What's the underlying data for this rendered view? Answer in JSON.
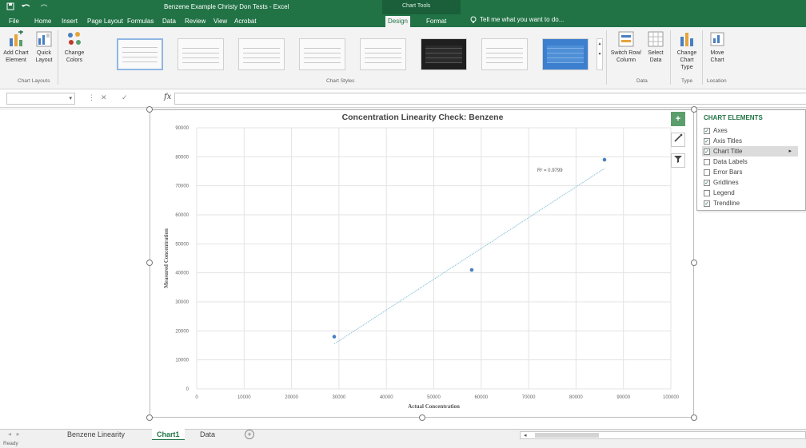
{
  "window": {
    "title": "Benzene Example Christy Don Tests - Excel",
    "context_tools_label": "Chart Tools"
  },
  "quick_access": {
    "save_icon": "save-icon",
    "undo_icon": "undo-icon",
    "redo_icon": "redo-icon"
  },
  "tabs": [
    "File",
    "Home",
    "Insert",
    "Page Layout",
    "Formulas",
    "Data",
    "Review",
    "View",
    "Acrobat",
    "Design",
    "Format"
  ],
  "active_tab": "Design",
  "tell_me": "Tell me what you want to do...",
  "ribbon": {
    "add_chart_element": "Add Chart Element",
    "quick_layout": "Quick Layout",
    "change_colors": "Change Colors",
    "chart_layouts_group": "Chart Layouts",
    "chart_styles_group": "Chart Styles",
    "switch_row_column": "Switch Row/ Column",
    "select_data": "Select Data",
    "data_group": "Data",
    "change_chart_type": "Change Chart Type",
    "type_group": "Type",
    "move_chart": "Move Chart",
    "location_group": "Location"
  },
  "formula_bar": {
    "name_box": "",
    "formula": "",
    "fx_label": "fx",
    "cancel_glyph": "✕",
    "enter_glyph": "✓"
  },
  "chart_data": {
    "type": "scatter",
    "title": "Concentration Linearity Check:  Benzene",
    "xlabel": "Actual Concentration",
    "ylabel": "Measured Concentration",
    "xlim": [
      0,
      100000
    ],
    "ylim": [
      0,
      90000
    ],
    "x_ticks": [
      "0",
      "10000",
      "20000",
      "30000",
      "40000",
      "50000",
      "60000",
      "70000",
      "80000",
      "90000",
      "100000"
    ],
    "y_ticks": [
      "0",
      "10000",
      "20000",
      "30000",
      "40000",
      "50000",
      "60000",
      "70000",
      "80000",
      "90000"
    ],
    "grid": true,
    "points": [
      {
        "x": 29000,
        "y": 18000
      },
      {
        "x": 58000,
        "y": 41000
      },
      {
        "x": 86000,
        "y": 79000
      }
    ],
    "trendline": {
      "x0": 29000,
      "y0": 15500,
      "x1": 86000,
      "y1": 76000
    },
    "r_squared_label": "R² = 0.9799",
    "point_color": "#4a7fc1",
    "trendline_color": "#8cc3d8"
  },
  "chart_elements_panel": {
    "title": "CHART ELEMENTS",
    "items": [
      {
        "label": "Axes",
        "checked": true
      },
      {
        "label": "Axis Titles",
        "checked": true
      },
      {
        "label": "Chart Title",
        "checked": true
      },
      {
        "label": "Data Labels",
        "checked": false
      },
      {
        "label": "Error Bars",
        "checked": false
      },
      {
        "label": "Gridlines",
        "checked": true
      },
      {
        "label": "Legend",
        "checked": false
      },
      {
        "label": "Trendline",
        "checked": true
      }
    ]
  },
  "sheet_tabs": [
    "Benzene Linearity",
    "Chart1",
    "Data"
  ],
  "active_sheet": "Chart1",
  "status": "Ready"
}
